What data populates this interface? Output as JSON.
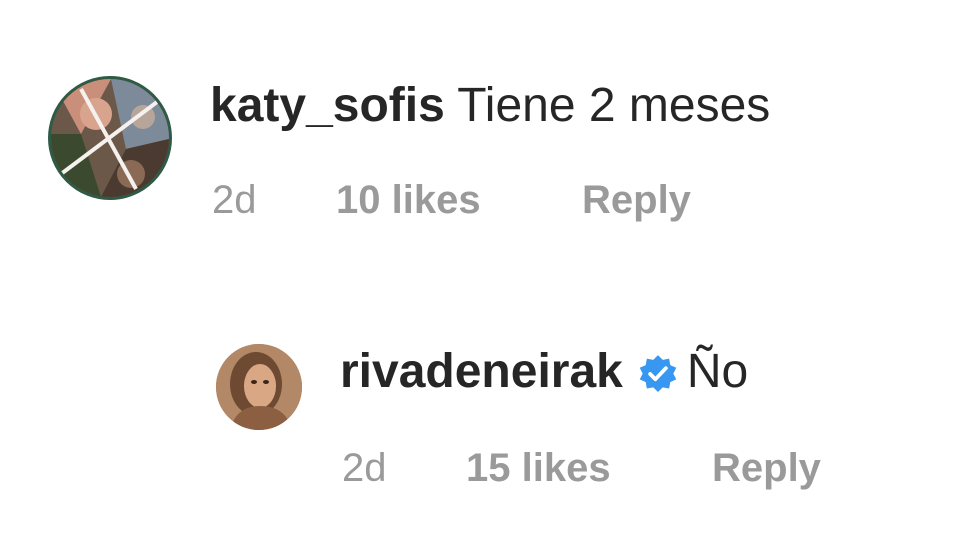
{
  "comments": [
    {
      "username": "katy_sofis",
      "text": "Tiene 2 meses",
      "time": "2d",
      "likes": "10 likes",
      "reply": "Reply",
      "verified": false
    },
    {
      "username": "rivadeneirak",
      "text": "Ño",
      "time": "2d",
      "likes": "15 likes",
      "reply": "Reply",
      "verified": true,
      "badge_icon": "verified-badge-icon",
      "badge_color": "#3897f0"
    }
  ]
}
